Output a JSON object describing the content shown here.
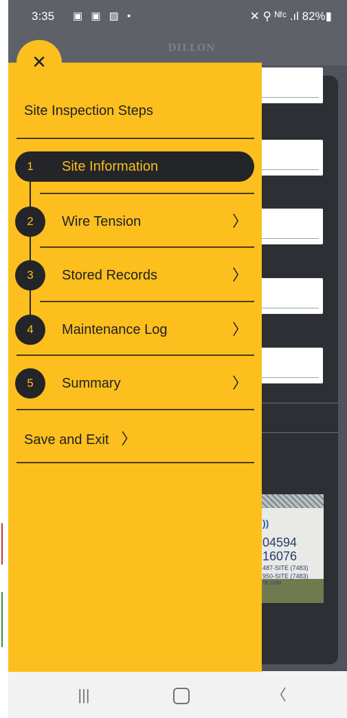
{
  "status_bar": {
    "time": "3:35",
    "notifications": "▣ ▣ ▨ •",
    "right": "✕ ⚲ ᴺᶠᶜ .ıl 82%▮"
  },
  "app": {
    "logo": "DILLON"
  },
  "photo_sign": {
    "line1": "))",
    "line2": "04594",
    "line3": "16076",
    "line4": "487-SITE (7483)",
    "line5": "950-SITE (7483)",
    "line6": "TE.COM"
  },
  "drawer": {
    "close_glyph": "✕",
    "title": "Site Inspection Steps",
    "steps": [
      {
        "num": "1",
        "label": "Site Information",
        "active": true
      },
      {
        "num": "2",
        "label": "Wire Tension",
        "chevron": "〉"
      },
      {
        "num": "3",
        "label": "Stored Records",
        "chevron": "〉"
      },
      {
        "num": "4",
        "label": "Maintenance Log",
        "chevron": "〉"
      },
      {
        "num": "5",
        "label": "Summary",
        "chevron": "〉"
      }
    ],
    "save_exit": {
      "label": "Save and Exit",
      "chevron": "〉"
    }
  },
  "nav_bar": {
    "recents_glyph": "|||",
    "back_glyph": "〈"
  },
  "colors": {
    "drawer": "#fcbf1e",
    "dark": "#232528"
  }
}
